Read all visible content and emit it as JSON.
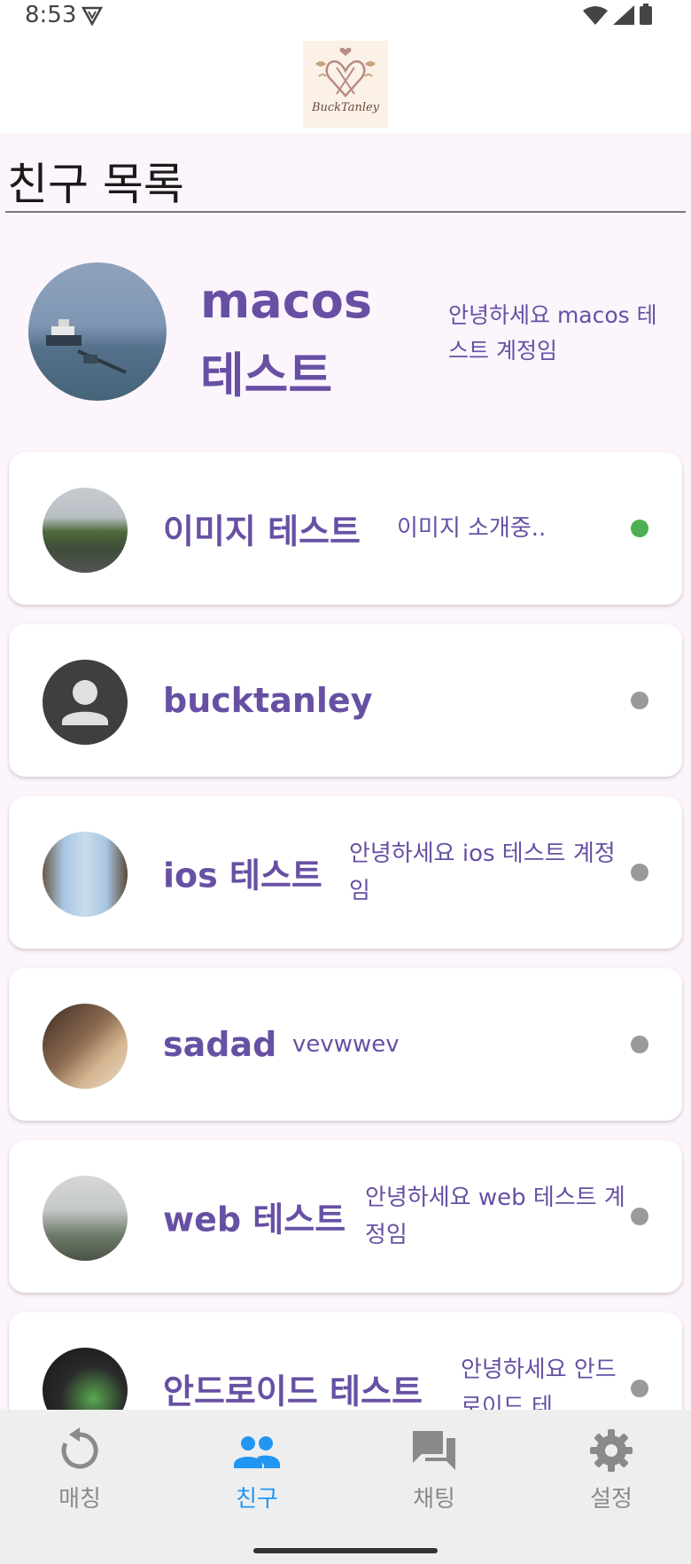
{
  "status_bar": {
    "time": "8:53"
  },
  "logo": {
    "text": "BuckTanley"
  },
  "page_title": "친구 목록",
  "me": {
    "name": "macos 테스트",
    "status": "안녕하세요 macos 테스트 계정임"
  },
  "friends": [
    {
      "name": "이미지 테스트",
      "status": "이미지 소개중..",
      "online": true
    },
    {
      "name": "bucktanley",
      "status": "",
      "online": false
    },
    {
      "name": "ios 테스트",
      "status": "안녕하세요 ios 테스트 계정임",
      "online": false
    },
    {
      "name": "sadad",
      "status": "vevwwev",
      "online": false
    },
    {
      "name": "web 테스트",
      "status": "안녕하세요 web 테스트 계정임",
      "online": false
    },
    {
      "name": "안드로이드 테스트",
      "status": "안녕하세요 안드로이드 테",
      "online": false
    }
  ],
  "bottom_nav": {
    "items": [
      {
        "label": "매칭",
        "icon": "refresh-icon",
        "active": false
      },
      {
        "label": "친구",
        "icon": "people-icon",
        "active": true
      },
      {
        "label": "채팅",
        "icon": "chat-icon",
        "active": false
      },
      {
        "label": "설정",
        "icon": "gear-icon",
        "active": false
      }
    ]
  },
  "colors": {
    "accent": "#6750a4",
    "active_nav": "#2196f3",
    "online": "#4caf50",
    "offline": "#9a9a9a",
    "background": "#fcf5fc"
  }
}
